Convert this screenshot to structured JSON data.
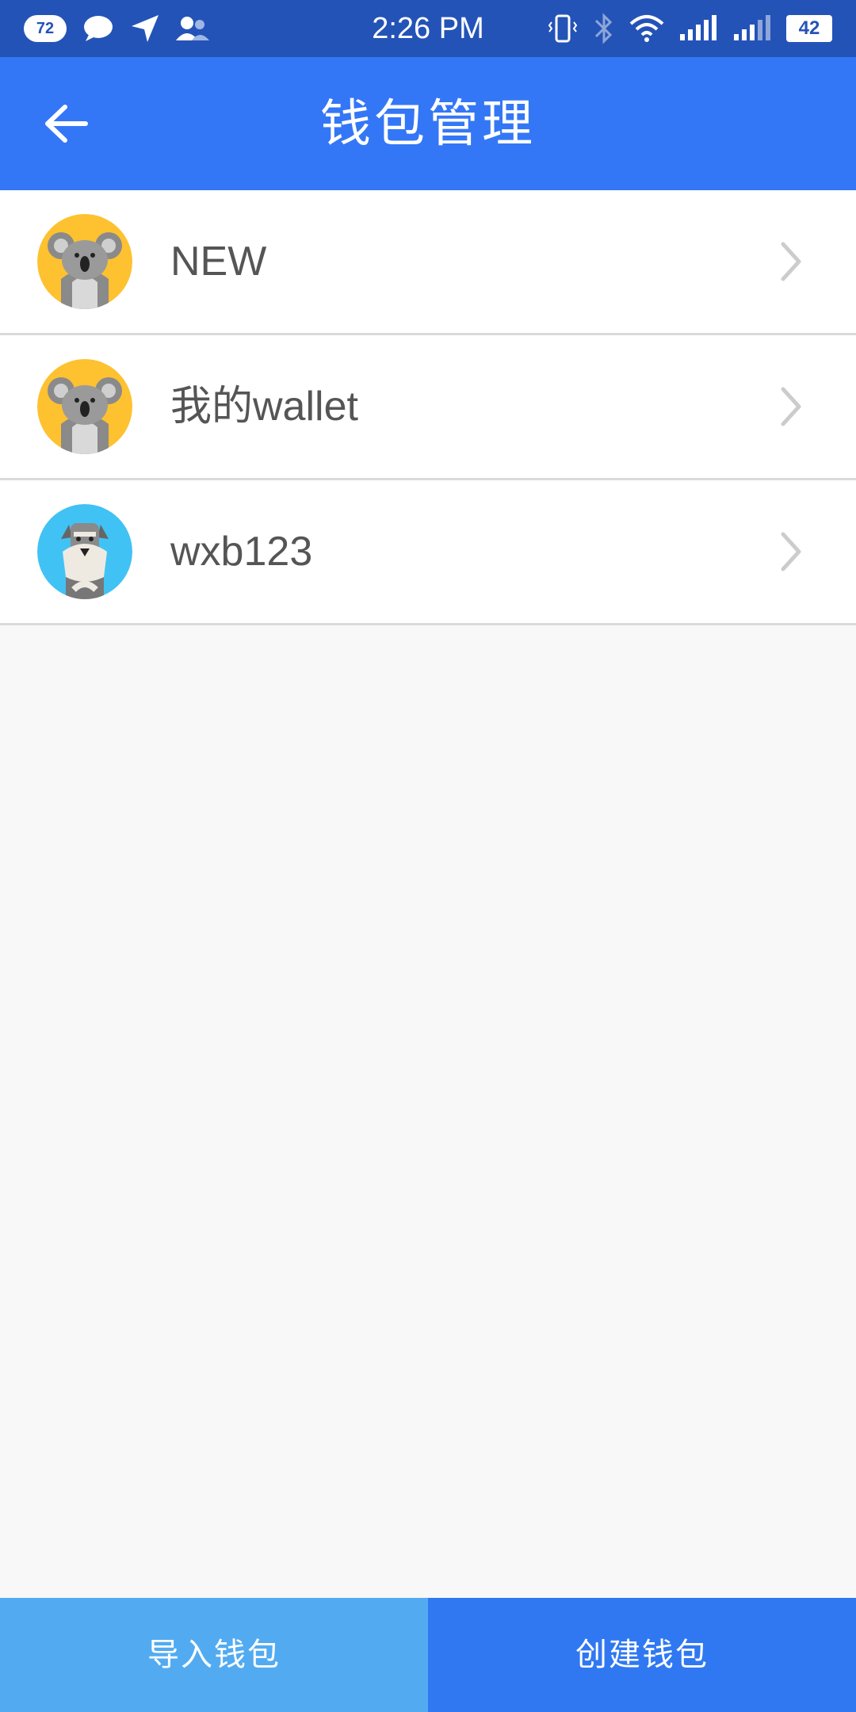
{
  "status_bar": {
    "notification_count": "72",
    "time": "2:26 PM",
    "battery": "42"
  },
  "header": {
    "title": "钱包管理",
    "back_icon": "arrow-left-icon"
  },
  "wallets": [
    {
      "name": "NEW",
      "avatar": "koala-icon"
    },
    {
      "name": "我的wallet",
      "avatar": "koala-icon"
    },
    {
      "name": "wxb123",
      "avatar": "dog-icon"
    }
  ],
  "actions": {
    "import_label": "导入钱包",
    "create_label": "创建钱包"
  },
  "colors": {
    "status_bar": "#2453b8",
    "app_bar": "#3477f6",
    "import_button": "#52abf1",
    "create_button": "#3078f2",
    "koala_bg": "#fec12f",
    "dog_bg": "#41c2f4"
  }
}
